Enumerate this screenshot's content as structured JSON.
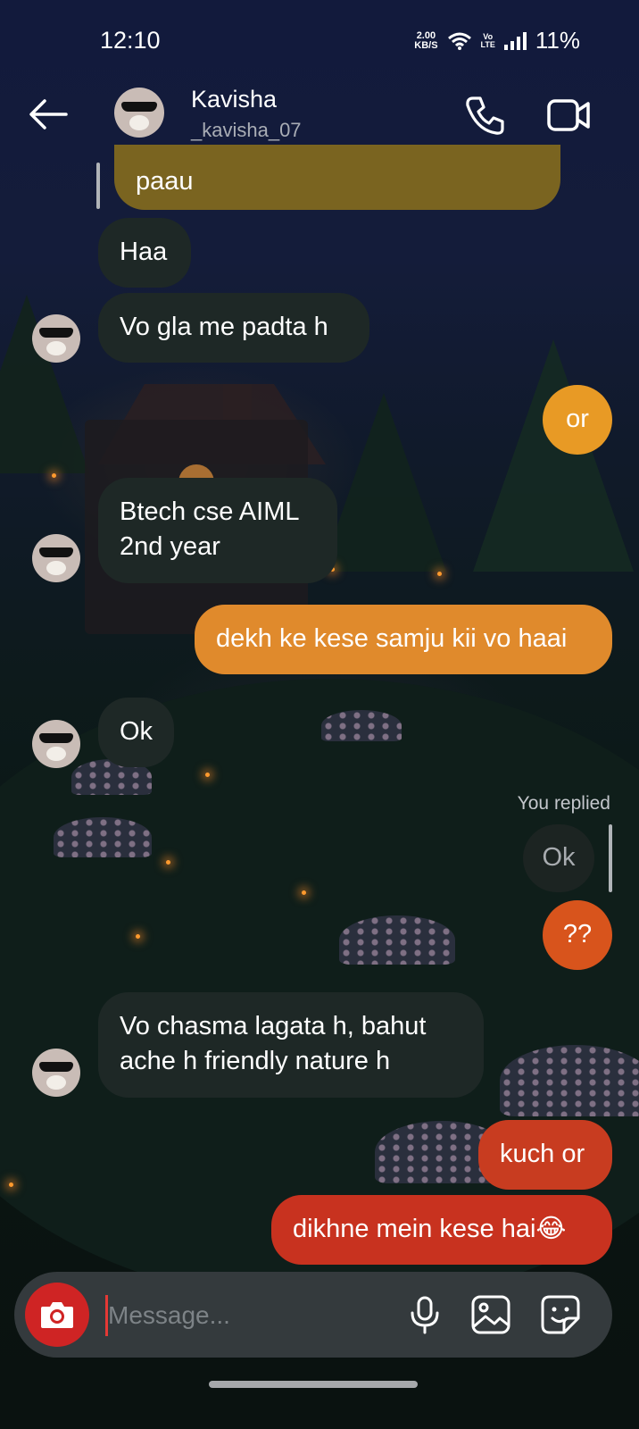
{
  "status_bar": {
    "time": "12:10",
    "net_speed_value": "2.00",
    "net_speed_unit": "KB/S",
    "volte_top": "Vo",
    "volte_bottom": "LTE",
    "battery": "11%"
  },
  "header": {
    "name": "Kavisha",
    "username": "_kavisha_07"
  },
  "messages": [
    {
      "text": "paau",
      "from": "me",
      "color": "#7a6420"
    },
    {
      "text": "Haa",
      "from": "them"
    },
    {
      "text": "Vo gla me padta h",
      "from": "them"
    },
    {
      "text": "or",
      "from": "me",
      "color": "#e89a25"
    },
    {
      "text": "Btech cse AIML\n2nd year",
      "from": "them"
    },
    {
      "text": "dekh ke kese samju kii vo haai",
      "from": "me",
      "color": "#e08a2c"
    },
    {
      "text": "Ok",
      "from": "them"
    },
    {
      "reply_label": "You replied",
      "quoted": "Ok"
    },
    {
      "text": "??",
      "from": "me",
      "color": "#d8541c"
    },
    {
      "text": "Vo chasma lagata h, bahut\nache h friendly nature h",
      "from": "them"
    },
    {
      "text": "kuch or",
      "from": "me",
      "color": "#c83c20"
    },
    {
      "text": "dikhne mein kese hai😂",
      "from": "me",
      "color": "#c8321f"
    }
  ],
  "composer": {
    "placeholder": "Message..."
  },
  "icons": {
    "back": "arrow-left-icon",
    "call": "phone-icon",
    "video": "video-camera-icon",
    "camera": "camera-icon",
    "mic": "microphone-icon",
    "gallery": "image-icon",
    "sticker": "sticker-icon"
  },
  "colors": {
    "incoming_bubble": "#1e2826",
    "camera_button": "#cf2424",
    "composer_bg": "#343a3d"
  }
}
